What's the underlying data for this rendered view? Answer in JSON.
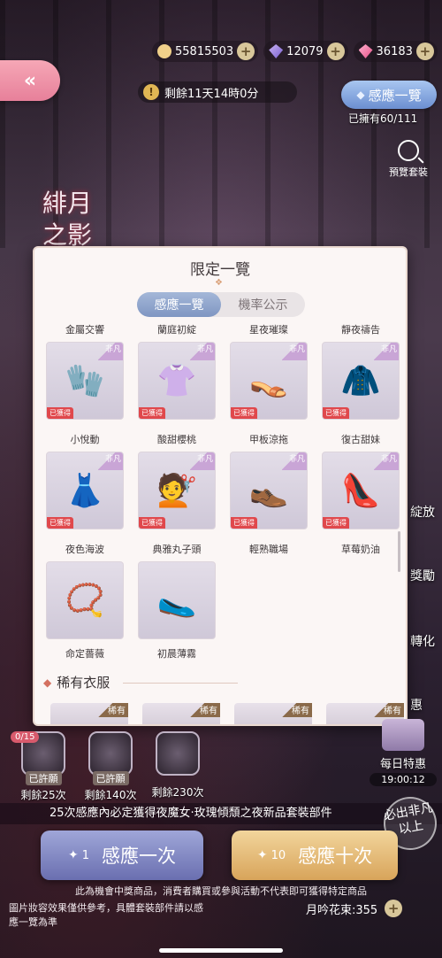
{
  "resources": [
    {
      "icon": "cat-coin-icon",
      "value": "55815503"
    },
    {
      "icon": "diamond-icon",
      "value": "12079"
    },
    {
      "icon": "pink-gem-icon",
      "value": "36183"
    }
  ],
  "back_label": "«",
  "timer": {
    "text": "剩餘11天14時0分"
  },
  "overview_button": "感應一覽",
  "owned_text": "已擁有60/111",
  "preview_label": "預覽套裝",
  "logo_text": "緋月之影",
  "modal": {
    "title": "限定一覽",
    "tabs": [
      {
        "label": "感應一覽",
        "active": true
      },
      {
        "label": "機率公示",
        "active": false
      }
    ],
    "items": [
      {
        "name": "金屬交響",
        "badge": "非凡",
        "got": "已獲得",
        "art": "🧤"
      },
      {
        "name": "蘭庭初綻",
        "badge": "非凡",
        "got": "已獲得",
        "art": "👚"
      },
      {
        "name": "星夜璀璨",
        "badge": "非凡",
        "got": "已獲得",
        "art": "👡"
      },
      {
        "name": "靜夜禱告",
        "badge": "非凡",
        "got": "已獲得",
        "art": "🧥"
      },
      {
        "name": "小悅動",
        "badge": "非凡",
        "got": "已獲得",
        "art": "👗"
      },
      {
        "name": "酸甜櫻桃",
        "badge": "非凡",
        "got": "已獲得",
        "art": "💇"
      },
      {
        "name": "甲板涼拖",
        "badge": "非凡",
        "got": "已獲得",
        "art": "👞"
      },
      {
        "name": "復古甜妹",
        "badge": "非凡",
        "got": "已獲得",
        "art": "👠"
      },
      {
        "name": "夜色海波",
        "badge": "",
        "got": "",
        "art": "📿",
        "below": "命定薔薇"
      },
      {
        "name": "典雅丸子頭",
        "badge": "",
        "got": "",
        "art": "🥿",
        "below": "初晨薄霧"
      },
      {
        "name": "輕熟職場",
        "badge": "",
        "got": "",
        "art": ""
      },
      {
        "name": "草莓奶油",
        "badge": "",
        "got": "",
        "art": ""
      }
    ],
    "rare_section": {
      "title": "稀有衣服",
      "tag": "稀有"
    }
  },
  "side_labels": [
    "綻放",
    "獎勵",
    "轉化",
    "惠"
  ],
  "wishes": [
    {
      "tag": "已許願",
      "remain": "剩餘25次"
    },
    {
      "tag": "已許願",
      "remain": "剩餘140次"
    },
    {
      "tag": "",
      "remain": "剩餘230次"
    }
  ],
  "wish_counter": "0/15",
  "daily": {
    "label": "每日特惠",
    "time": "19:00:12"
  },
  "marquee": "25次感應內必定獲得夜魔女·玫瑰傾頹之夜新品套裝部件",
  "rare_stamp": "必出非凡以上",
  "draw_one": {
    "cost": "1",
    "label": "感應一次"
  },
  "draw_ten": {
    "cost": "10",
    "label": "感應十次"
  },
  "disclaimer": "此為機會中獎商品，消費者購買或參與活動不代表即可獲得特定商品",
  "note": "圖片妝容效果僅供參考，具體套裝部件請以感應一覽為準",
  "flower": "月吟花束:355"
}
